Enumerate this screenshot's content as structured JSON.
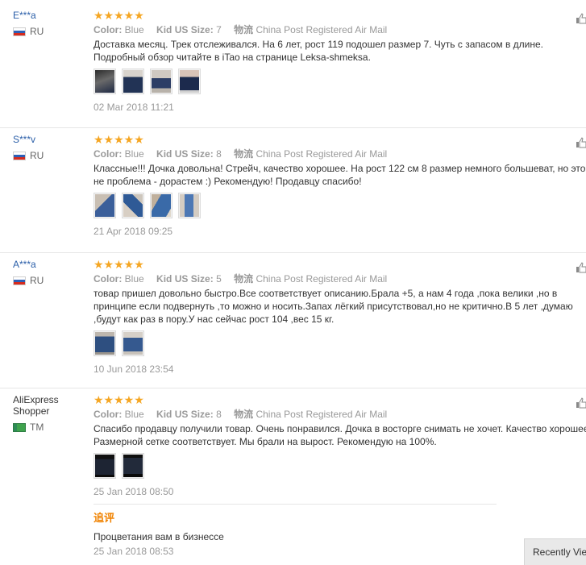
{
  "reviews": [
    {
      "user": "E***a",
      "country": "RU",
      "stars": "★★★★★",
      "color_label": "Color:",
      "color_value": "Blue",
      "size_label": "Kid US Size:",
      "size_value": "7",
      "ship_label": "物流",
      "ship_value": "China Post Registered Air Mail",
      "text": "Доставка месяц. Трек отслеживался. На 6 лет, рост 119 подошел размер 7. Чуть с запасом в длине. Подробный обзор читайте в iTao на странице Leksa-shmeksa.",
      "date": "02 Mar 2018 11:21"
    },
    {
      "user": "S***v",
      "country": "RU",
      "stars": "★★★★★",
      "color_label": "Color:",
      "color_value": "Blue",
      "size_label": "Kid US Size:",
      "size_value": "8",
      "ship_label": "物流",
      "ship_value": "China Post Registered Air Mail",
      "text": "Классные!!! Дочка довольна! Стрейч, качество хорошее. На рост 122 см 8 размер немного большеват, но это не проблема - дорастем :) Рекомендую! Продавцу спасибо!",
      "date": "21 Apr 2018 09:25"
    },
    {
      "user": "A***a",
      "country": "RU",
      "stars": "★★★★★",
      "color_label": "Color:",
      "color_value": "Blue",
      "size_label": "Kid US Size:",
      "size_value": "5",
      "ship_label": "物流",
      "ship_value": "China Post Registered Air Mail",
      "text": "товар пришел довольно быстро.Все соответствует описанию.Брала +5, а нам 4 года ,пока велики ,но в принципе если подвернуть ,то можно и носить.Запах лёгкий присутствовал,но не критично.В 5 лет ,думаю ,будут как раз в пору.У нас сейчас рост 104 ,вес 15 кг.",
      "date": "10 Jun 2018 23:54"
    },
    {
      "user": "AliExpress Shopper",
      "country": "TM",
      "stars": "★★★★★",
      "color_label": "Color:",
      "color_value": "Blue",
      "size_label": "Kid US Size:",
      "size_value": "8",
      "ship_label": "物流",
      "ship_value": "China Post Registered Air Mail",
      "text": "Спасибо продавцу получили товар. Очень понравился. Дочка в восторге снимать не хочет. Качество хорошее. Размерной сетке соответствует. Мы брали на вырост. Рекомендую на 100%.",
      "date": "25 Jan 2018 08:50",
      "reply_label": "追评",
      "reply_text": "Процветания вам в бизнессе",
      "reply_date": "25 Jan 2018 08:53"
    }
  ],
  "recently_viewed": "Recently Viewed",
  "colors": {
    "star": "#f5a623",
    "username": "#2a5ea8",
    "reply": "#f08200"
  }
}
